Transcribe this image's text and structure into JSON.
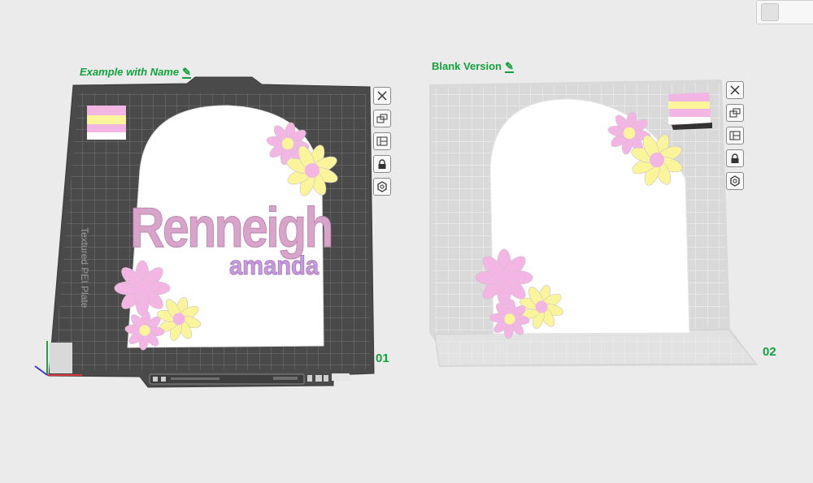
{
  "plates": [
    {
      "title": "Example with Name",
      "number": "01",
      "bed_label": "Textured PEI Plate",
      "name_main": "Renneigh",
      "name_sub": "amanda"
    },
    {
      "title": "Blank Version",
      "number": "02"
    }
  ],
  "toolbar_icons": [
    "close-icon",
    "auto-orient-icon",
    "arrange-icon",
    "lock-icon",
    "settings-icon"
  ],
  "colors": {
    "accent_green": "#12a23c",
    "dark_bed": "#4a4a4a",
    "light_bed": "#d9d9d9",
    "pink": "#f3b5e3",
    "yellow": "#faf59a",
    "violet": "#c79bdc",
    "mauve": "#d8a4c9"
  }
}
